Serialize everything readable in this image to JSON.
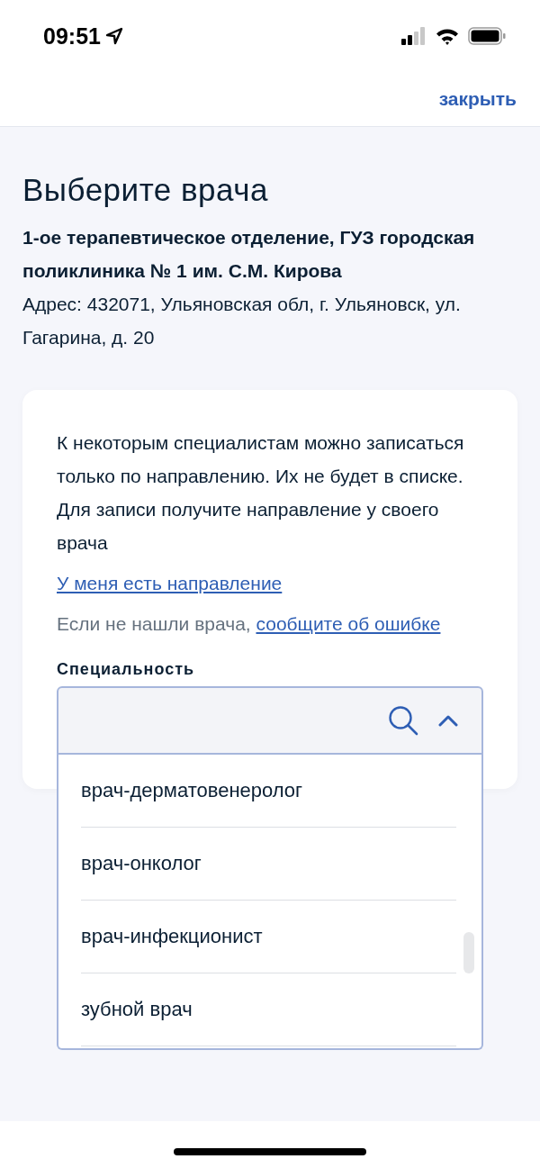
{
  "status_bar": {
    "time": "09:51"
  },
  "header": {
    "close_link": "закрыть"
  },
  "title": "Выберите врача",
  "department": "1-ое терапевтическое отделение, ГУЗ городская поликлиника № 1 им. С.М. Кирова",
  "address": "Адрес: 432071, Ульяновская обл, г. Ульяновск, ул. Гагарина, д. 20",
  "card": {
    "note": "К некоторым специалистам можно записаться только по направлению. Их не будет в списке. Для записи получите направление у своего врача",
    "referral_link": "У меня есть направление",
    "report_text": "Если не нашли врача,",
    "report_link": "сообщите об ошибке"
  },
  "specialty": {
    "label": "Специальность",
    "expanded": true,
    "options": [
      {
        "label": "врач-дерматовенеролог"
      },
      {
        "label": "врач-онколог"
      },
      {
        "label": "врач-инфекционист"
      },
      {
        "label": "зубной врач"
      }
    ]
  }
}
